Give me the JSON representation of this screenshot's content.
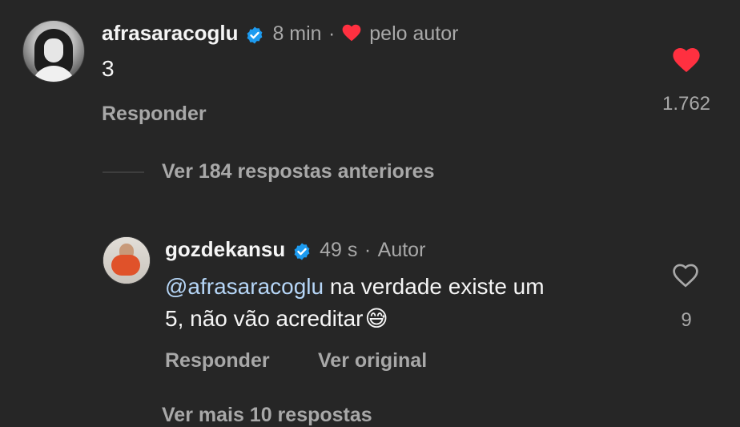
{
  "comment1": {
    "username": "afrasaracoglu",
    "time": "8 min",
    "separator": "·",
    "liked_by_author": "pelo autor",
    "text": "3",
    "reply_label": "Responder",
    "like_count": "1.762",
    "liked": true
  },
  "view_previous": "Ver 184 respostas anteriores",
  "comment2": {
    "username": "gozdekansu",
    "time": "49 s",
    "separator": "·",
    "author_tag": "Autor",
    "mention": "@afrasaracoglu",
    "text_line1": " na verdade existe um",
    "text_line2": "5, não vão acreditar",
    "emoji": "😅",
    "reply_label": "Responder",
    "see_original_label": "Ver original",
    "like_count": "9",
    "liked": false
  },
  "view_more_partial": "Ver mais 10 respostas",
  "colors": {
    "background": "#262626",
    "primary_text": "#f5f5f5",
    "secondary_text": "#a8a8a8",
    "heart_red": "#ff3040",
    "verified_blue": "#1d9bf0",
    "mention": "#b6d6f7"
  },
  "icons": {
    "verified": "verified-badge-icon",
    "heart_filled": "heart-filled-icon",
    "heart_outline": "heart-outline-icon"
  }
}
